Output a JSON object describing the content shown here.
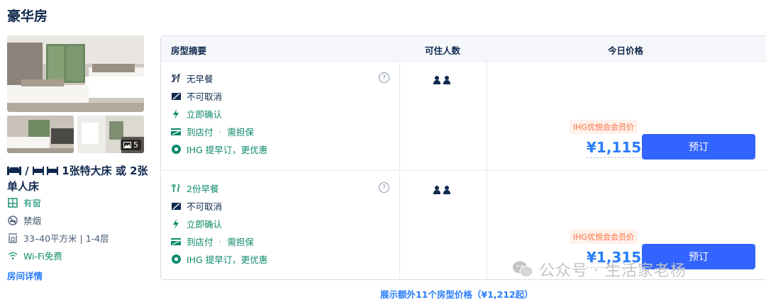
{
  "room": {
    "title": "豪华房",
    "photo_count": "5",
    "bed_sep": "/",
    "bed_desc": "1张特大床 或 2张单人床",
    "features": [
      {
        "icon": "window-icon",
        "label": "有窗",
        "tone": "green"
      },
      {
        "icon": "no-smoking-icon",
        "label": "禁烟",
        "tone": "gray"
      },
      {
        "icon": "area-floor-icon",
        "label": "33–40平方米 | 1-4层",
        "tone": "gray"
      },
      {
        "icon": "wifi-icon",
        "label": "Wi-Fi免费",
        "tone": "green"
      }
    ],
    "details_link": "房间详情"
  },
  "table": {
    "headers": {
      "summary": "房型摘要",
      "guests": "可住人数",
      "price": "今日价格"
    },
    "rows": [
      {
        "meal": "无早餐",
        "cancel": "不可取消",
        "confirm": "立即确认",
        "pay": "到店付",
        "pay_sep": "·",
        "pay_note": "需担保",
        "ihg": "IHG 提早订，更优惠",
        "help": "?",
        "member_badge": "IHG优悦会会员价",
        "price": "¥1,115",
        "book": "预订"
      },
      {
        "meal": "2份早餐",
        "cancel": "不可取消",
        "confirm": "立即确认",
        "pay": "到店付",
        "pay_sep": "·",
        "pay_note": "需担保",
        "ihg": "IHG 提早订，更优惠",
        "help": "?",
        "member_badge": "IHG优悦会会员价",
        "price": "¥1,315",
        "book": "预订"
      }
    ],
    "more_link": "展示额外11个房型价格（¥1,212起）"
  },
  "watermark": "公众号 · 生活家老杨",
  "colors": {
    "accent": "#287dfa",
    "button": "#3264ff",
    "green": "#0b8a6a",
    "badge": "#ff6f3d",
    "text": "#0f294d"
  }
}
